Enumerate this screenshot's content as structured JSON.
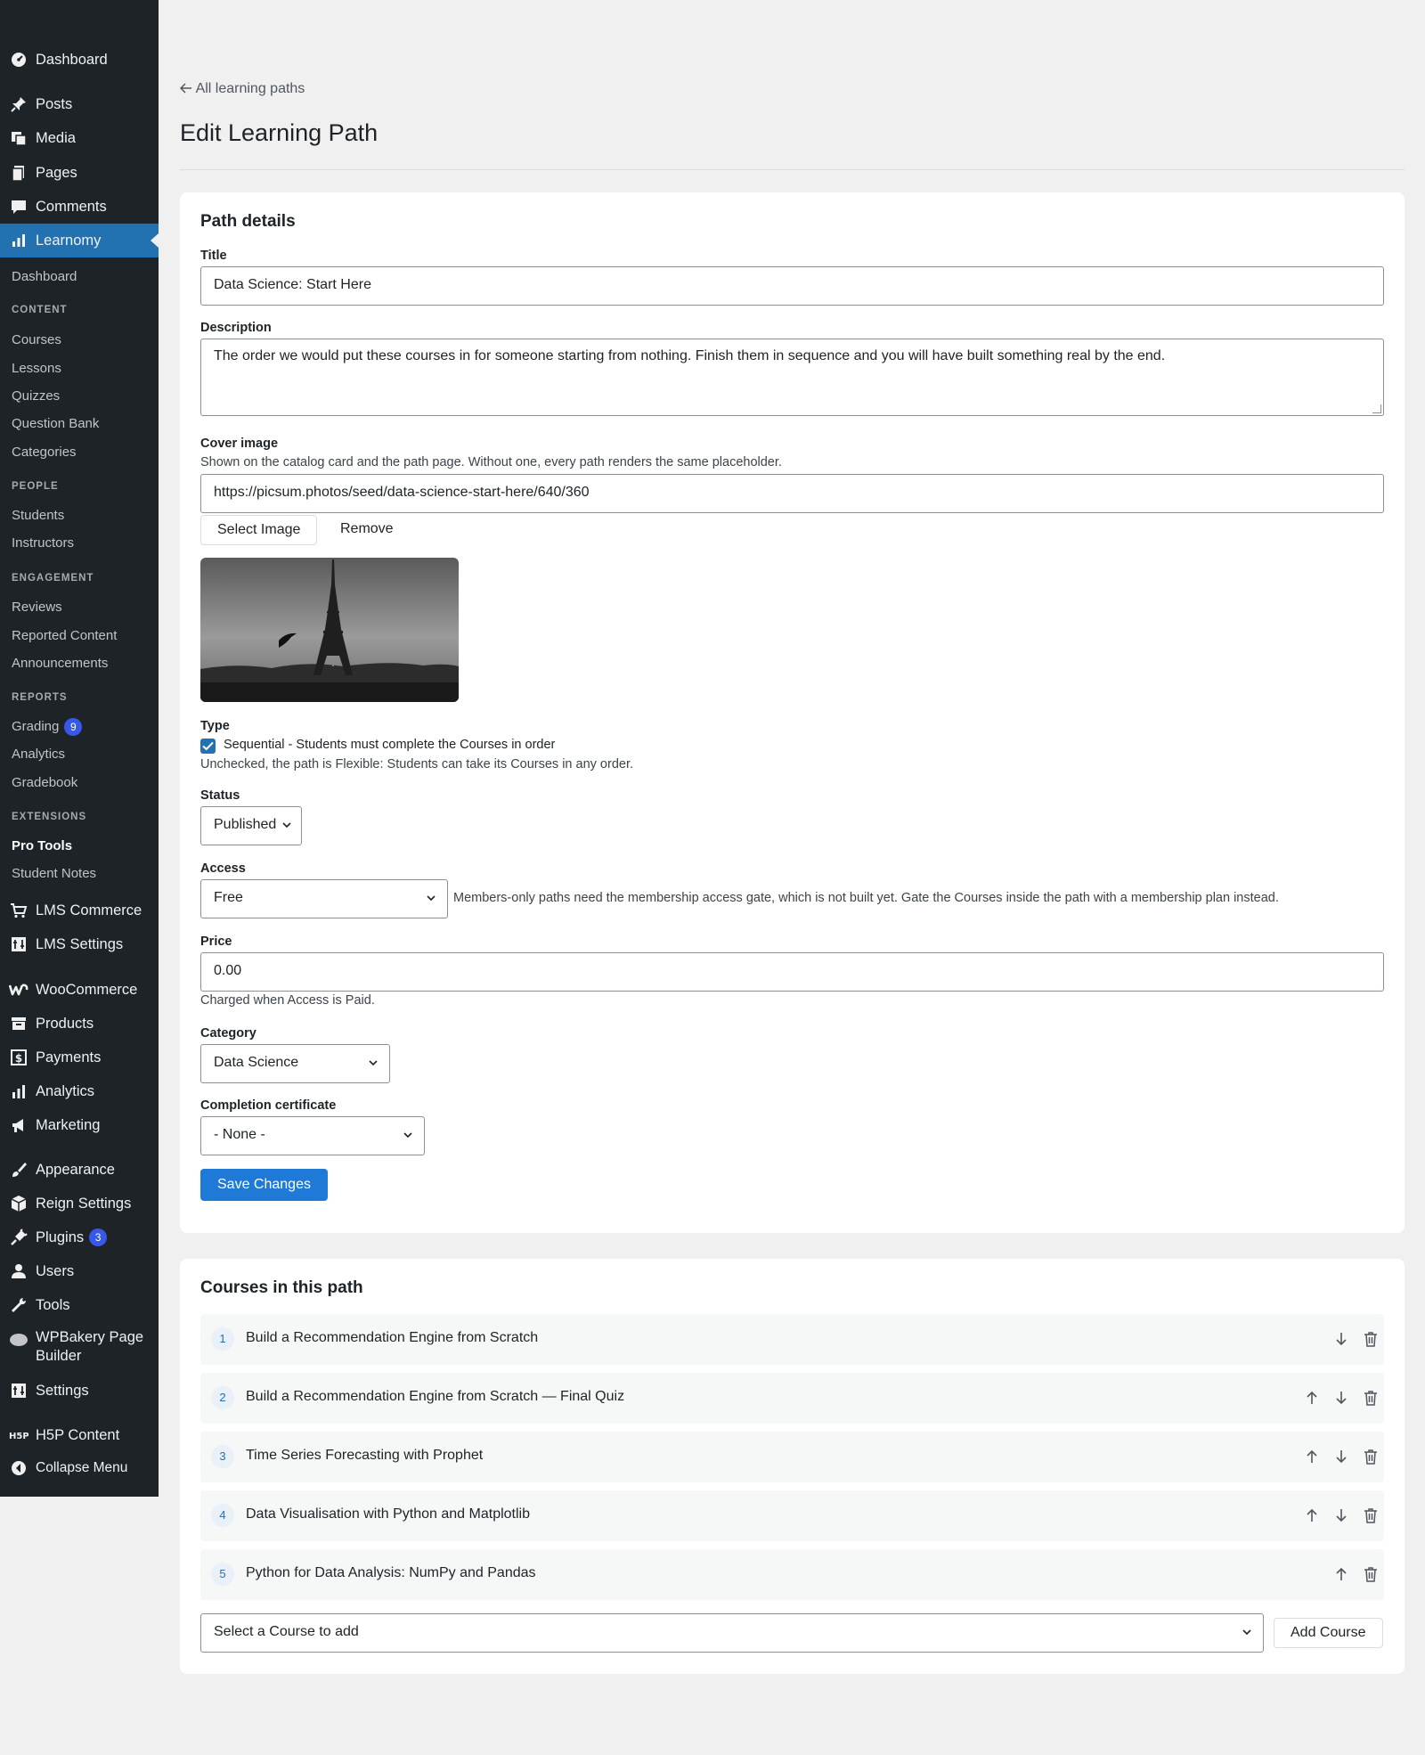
{
  "sidebar": {
    "top": [
      {
        "label": "Dashboard",
        "icon": "dashboard-icon"
      },
      {
        "label": "Posts",
        "icon": "pin-icon"
      },
      {
        "label": "Media",
        "icon": "media-icon"
      },
      {
        "label": "Pages",
        "icon": "pages-icon"
      },
      {
        "label": "Comments",
        "icon": "comments-icon"
      },
      {
        "label": "Learnomy",
        "icon": "bar-chart-icon"
      }
    ],
    "learnomy_sub": {
      "dashboard": "Dashboard",
      "content_heading": "CONTENT",
      "courses": "Courses",
      "lessons": "Lessons",
      "quizzes": "Quizzes",
      "question_bank": "Question Bank",
      "categories": "Categories",
      "people_heading": "PEOPLE",
      "students": "Students",
      "instructors": "Instructors",
      "engagement_heading": "ENGAGEMENT",
      "reviews": "Reviews",
      "reported_content": "Reported Content",
      "announcements": "Announcements",
      "reports_heading": "REPORTS",
      "grading": "Grading",
      "grading_badge": "9",
      "analytics": "Analytics",
      "gradebook": "Gradebook",
      "extensions_heading": "EXTENSIONS",
      "pro_tools": "Pro Tools",
      "student_notes": "Student Notes"
    },
    "bottom": {
      "lms_commerce": "LMS Commerce",
      "lms_settings": "LMS Settings",
      "woocommerce": "WooCommerce",
      "products": "Products",
      "payments": "Payments",
      "analytics": "Analytics",
      "marketing": "Marketing",
      "appearance": "Appearance",
      "reign_settings": "Reign Settings",
      "plugins": "Plugins",
      "plugins_badge": "3",
      "users": "Users",
      "tools": "Tools",
      "wpbakery_1": "WPBakery Page",
      "wpbakery_2": "Builder",
      "settings": "Settings",
      "h5p": "H5P Content",
      "collapse": "Collapse Menu"
    }
  },
  "header": {
    "back_link": "All learning paths",
    "title": "Edit Learning Path"
  },
  "details": {
    "card_title": "Path details",
    "title_label": "Title",
    "title_value": "Data Science: Start Here",
    "description_label": "Description",
    "description_value": "The order we would put these courses in for someone starting from nothing. Finish them in sequence and you will have built something real by the end.",
    "cover_label": "Cover image",
    "cover_help": "Shown on the catalog card and the path page. Without one, every path renders the same placeholder.",
    "cover_url": "https://picsum.photos/seed/data-science-start-here/640/360",
    "select_image": "Select Image",
    "remove": "Remove",
    "type_label": "Type",
    "type_checkbox": "Sequential - Students must complete the Courses in order",
    "type_help": "Unchecked, the path is Flexible: Students can take its Courses in any order.",
    "status_label": "Status",
    "status_value": "Published",
    "access_label": "Access",
    "access_value": "Free",
    "access_help": "Members-only paths need the membership access gate, which is not built yet. Gate the Courses inside the path with a membership plan instead.",
    "price_label": "Price",
    "price_value": "0.00",
    "price_help": "Charged when Access is Paid.",
    "category_label": "Category",
    "category_value": "Data Science",
    "certificate_label": "Completion certificate",
    "certificate_value": "- None -",
    "save_button": "Save Changes"
  },
  "courses": {
    "card_title": "Courses in this path",
    "items": [
      {
        "num": "1",
        "title": "Build a Recommendation Engine from Scratch"
      },
      {
        "num": "2",
        "title": "Build a Recommendation Engine from Scratch — Final Quiz"
      },
      {
        "num": "3",
        "title": "Time Series Forecasting with Prophet"
      },
      {
        "num": "4",
        "title": "Data Visualisation with Python and Matplotlib"
      },
      {
        "num": "5",
        "title": "Python for Data Analysis: NumPy and Pandas"
      }
    ],
    "add_placeholder": "Select a Course to add",
    "add_button": "Add Course"
  },
  "colors": {
    "sidebar_bg": "#1d2327",
    "active": "#2271b1",
    "primary_button": "#1e7ad6",
    "badge": "#3858e9"
  }
}
